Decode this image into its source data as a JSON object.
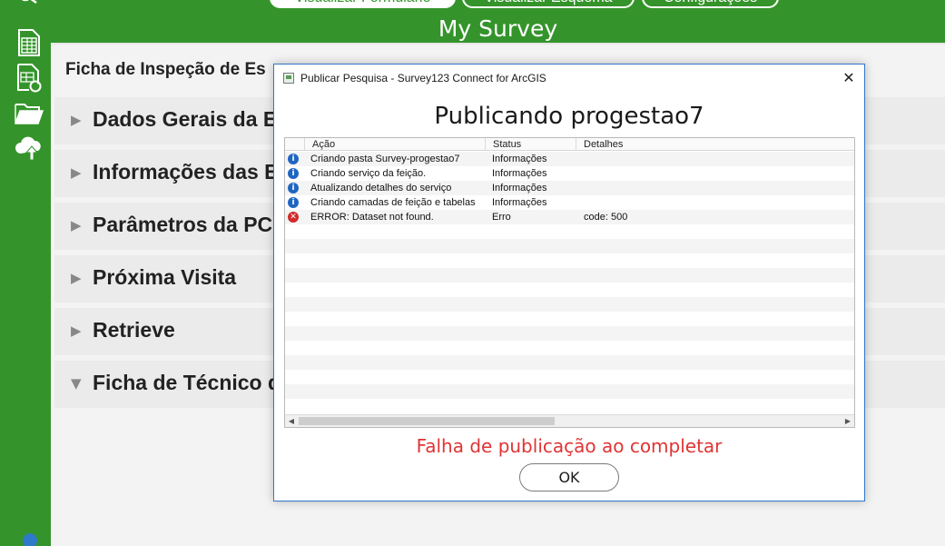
{
  "app": {
    "colors": {
      "brand_green": "#34942b",
      "dialog_border": "#2f77c8",
      "error_red": "#e03434"
    },
    "header": {
      "title": "My Survey",
      "tabs": [
        {
          "label": "Visualizar Formulário",
          "active": true
        },
        {
          "label": "Visualizar Esquema",
          "active": false
        },
        {
          "label": "Configurações",
          "active": false
        }
      ]
    },
    "sidebar": {
      "items": [
        {
          "icon": "spreadsheet-icon"
        },
        {
          "icon": "sync-spreadsheet-icon"
        },
        {
          "icon": "folder-icon"
        },
        {
          "icon": "cloud-upload-icon"
        }
      ]
    }
  },
  "form": {
    "title": "Ficha de Inspeção de Es",
    "sections": [
      {
        "label": "Dados Gerais da E",
        "arrow": "▶"
      },
      {
        "label": "Informações das E",
        "arrow": "▶"
      },
      {
        "label": "Parâmetros da PC",
        "arrow": "▶"
      },
      {
        "label": "Próxima Visita",
        "arrow": "▶"
      },
      {
        "label": "Retrieve",
        "arrow": "▶"
      },
      {
        "label": "Ficha de Técnico d",
        "arrow": "▼"
      }
    ]
  },
  "dialog": {
    "title": "Publicar Pesquisa - Survey123 Connect for ArcGIS",
    "heading": "Publicando progestao7",
    "columns": {
      "action": "Ação",
      "status": "Status",
      "details": "Detalhes"
    },
    "rows": [
      {
        "type": "info",
        "action": "Criando pasta Survey-progestao7",
        "status": "Informações",
        "details": ""
      },
      {
        "type": "info",
        "action": "Criando serviço da feição.",
        "status": "Informações",
        "details": ""
      },
      {
        "type": "info",
        "action": "Atualizando detalhes do serviço",
        "status": "Informações",
        "details": ""
      },
      {
        "type": "info",
        "action": "Criando camadas de feição e tabelas",
        "status": "Informações",
        "details": ""
      },
      {
        "type": "error",
        "action": "ERROR: Dataset not found.",
        "status": "Erro",
        "details": "code: 500"
      }
    ],
    "failure_message": "Falha de publicação ao completar",
    "ok_label": "OK"
  }
}
